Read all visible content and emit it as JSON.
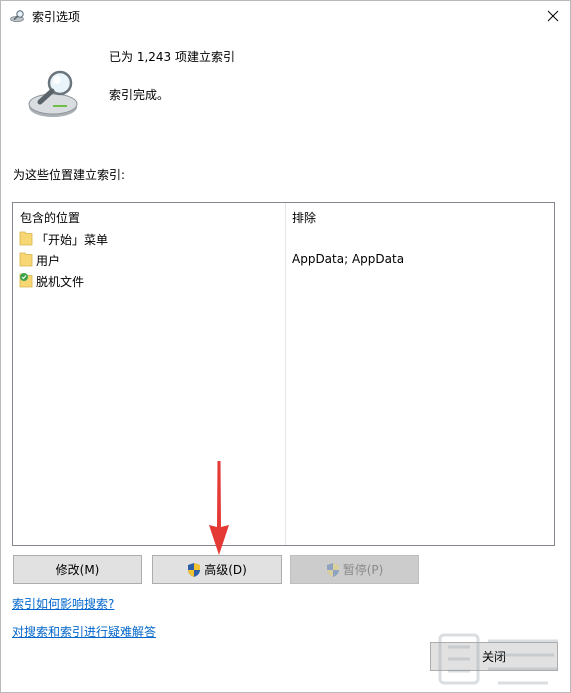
{
  "window": {
    "title": "索引选项"
  },
  "status": {
    "indexed_count": "已为 1,243 项建立索引",
    "message": "索引完成。"
  },
  "locations": {
    "label": "为这些位置建立索引:",
    "columns": {
      "included": "包含的位置",
      "excluded": "排除"
    },
    "rows": [
      {
        "name": "「开始」菜单",
        "exclude": "",
        "icon": "folder-icon"
      },
      {
        "name": "用户",
        "exclude": "AppData; AppData",
        "icon": "folder-icon"
      },
      {
        "name": "脱机文件",
        "exclude": "",
        "icon": "offline-files-icon"
      }
    ]
  },
  "buttons": {
    "modify": "修改(M)",
    "advanced": "高级(D)",
    "pause": "暂停(P)",
    "close": "关闭"
  },
  "links": {
    "how_indexing_affects": "索引如何影响搜索?",
    "troubleshoot": "对搜索和索引进行疑难解答"
  },
  "colors": {
    "link": "#0066cc",
    "button_bg": "#e1e1e1",
    "arrow": "#e53935"
  }
}
